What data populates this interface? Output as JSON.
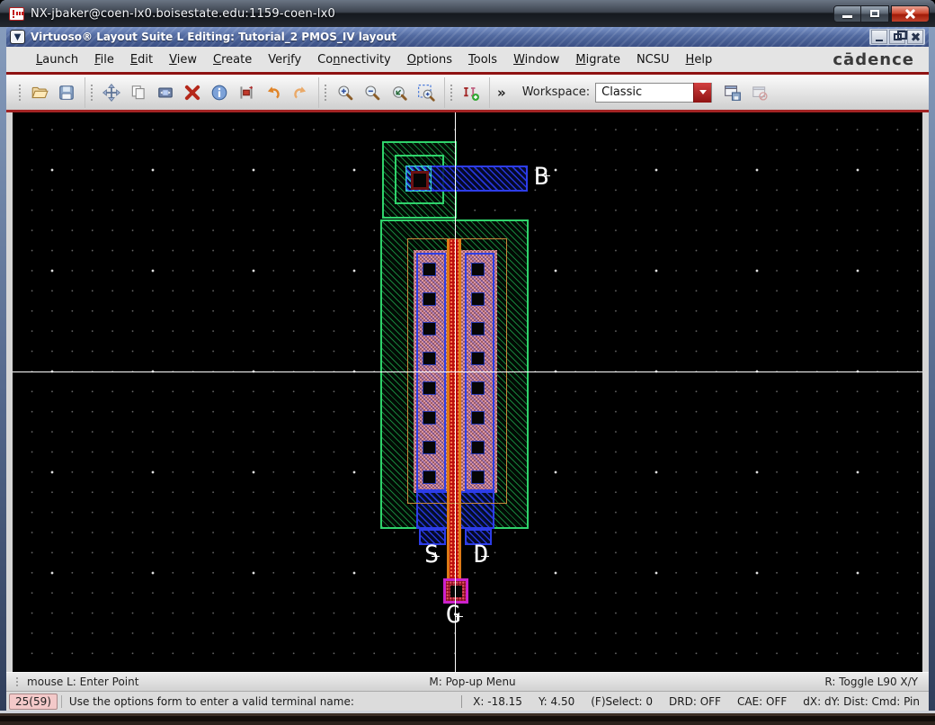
{
  "window": {
    "title": "NX-jbaker@coen-lx0.boisestate.edu:1159-coen-lx0"
  },
  "app": {
    "title": "Virtuoso® Layout Suite L Editing: Tutorial_2 PMOS_IV layout"
  },
  "menu": {
    "items": [
      {
        "label": "Launch",
        "mnemonic": 0
      },
      {
        "label": "File",
        "mnemonic": 0
      },
      {
        "label": "Edit",
        "mnemonic": 0
      },
      {
        "label": "View",
        "mnemonic": 0
      },
      {
        "label": "Create",
        "mnemonic": 0
      },
      {
        "label": "Verify",
        "mnemonic": 3
      },
      {
        "label": "Connectivity",
        "mnemonic": 2
      },
      {
        "label": "Options",
        "mnemonic": 0
      },
      {
        "label": "Tools",
        "mnemonic": 0
      },
      {
        "label": "Window",
        "mnemonic": 0
      },
      {
        "label": "Migrate",
        "mnemonic": 0
      },
      {
        "label": "NCSU",
        "mnemonic": -1
      },
      {
        "label": "Help",
        "mnemonic": 0
      }
    ]
  },
  "brand": {
    "logo": "cādence"
  },
  "toolbar": {
    "workspace_label": "Workspace:",
    "workspace_value": "Classic",
    "overflow_label": "»",
    "icons": [
      "open",
      "save",
      "move",
      "copy",
      "stretch",
      "delete",
      "properties",
      "rotate",
      "undo",
      "redo",
      "zoom-in",
      "zoom-out",
      "zoom-fit",
      "zoom-area",
      "create-via",
      "save-workspace",
      "revert-workspace"
    ]
  },
  "canvas": {
    "labels": {
      "bulk": "B",
      "source": "S",
      "drain": "D",
      "gate": "G"
    },
    "colors": {
      "nwell_border": "#2fd36b",
      "metal1": "#2d3de8",
      "poly": "#bb0f0d",
      "poly_edge": "#dd7a16",
      "pselect": "#c9893a",
      "pdiff": "#dc96a2",
      "contact_pad_cyan": "#2fc0c0",
      "poly_contact": "#cc22cc",
      "accent_red": "#8f1313"
    }
  },
  "hintbar": {
    "left": "mouse L: Enter Point",
    "center": "M: Pop-up Menu",
    "right": "R: Toggle L90 X/Y"
  },
  "statusbar": {
    "counter": "25(59)",
    "message": "Use the options form to enter a valid terminal name:",
    "coord_x": "X: -18.15",
    "coord_y": "Y: 4.50",
    "select": "(F)Select: 0",
    "drd": "DRD: OFF",
    "cae": "CAE: OFF",
    "deltas": "dX: dY: Dist: Cmd: Pin"
  }
}
